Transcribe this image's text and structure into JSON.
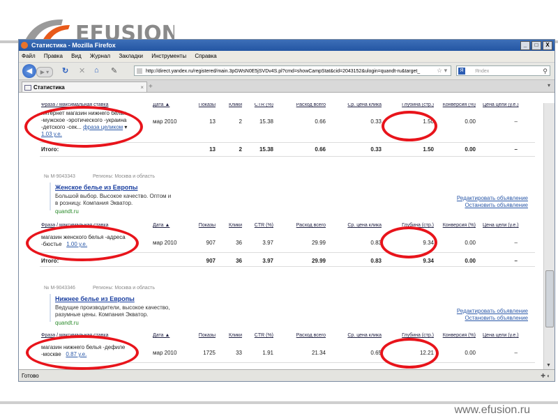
{
  "slide": {
    "logo_text": "EFUSION",
    "site": "www.efusion.ru"
  },
  "window": {
    "title": "Статистика - Mozilla Firefox",
    "buttons": [
      "_",
      "□",
      "X"
    ],
    "menu": [
      "Файл",
      "Правка",
      "Вид",
      "Журнал",
      "Закладки",
      "Инструменты",
      "Справка"
    ],
    "url": "http://direct.yandex.ru/registered/main.3pGWsN0E5jSVDv4S.pl?cmd=showCampStat&cid=2043152&ulogin=quandt-ru&target_",
    "search_placeholder": "Яndex",
    "tab_label": "Статистика",
    "status": "Готово"
  },
  "columns": {
    "phrase": "Фраза / максимальная ставка",
    "date": "Дата ▲",
    "shows": "Показы",
    "clicks": "Клики",
    "ctr": "CTR (%)",
    "spend": "Расход всего",
    "cpc": "Ср. цена клика",
    "depth": "Глубина (стр.)",
    "conv": "Конверсия (%)",
    "goal": "Цена цели (у.е.)"
  },
  "total_label": "Итого:",
  "block1": {
    "phrase_lines": [
      "интернет магазин нижнего белья",
      "-мужское -эротического -украина",
      "-детского -сек..."
    ],
    "phrase_link": "фраза целиком",
    "bid_link": "1.03 у.е.",
    "row": {
      "date": "мар 2010",
      "shows": "13",
      "clicks": "2",
      "ctr": "15.38",
      "spend": "0.66",
      "cpc": "0.33",
      "depth": "1.50",
      "conv": "0.00",
      "goal": "–"
    },
    "total": {
      "shows": "13",
      "clicks": "2",
      "ctr": "15.38",
      "spend": "0.66",
      "cpc": "0.33",
      "depth": "1.50",
      "conv": "0.00",
      "goal": "–"
    }
  },
  "block2": {
    "ad_id": "№ M-9043343",
    "regions": "Регионы: Москва и область",
    "ad_title": "Женское белье из Европы",
    "ad_text": [
      "Большой выбор. Высокое качество. Оптом и",
      "в розницу. Компания Экватор."
    ],
    "ad_url": "quandt.ru",
    "edit_link": "Редактировать объявление",
    "stop_link": "Остановить объявление",
    "phrase_lines": [
      "магазин женского белья -адреса",
      "-бюстье"
    ],
    "bid_link": "1.00 у.е.",
    "row": {
      "date": "мар 2010",
      "shows": "907",
      "clicks": "36",
      "ctr": "3.97",
      "spend": "29.99",
      "cpc": "0.83",
      "depth": "9.34",
      "conv": "0.00",
      "goal": "–"
    },
    "total": {
      "shows": "907",
      "clicks": "36",
      "ctr": "3.97",
      "spend": "29.99",
      "cpc": "0.83",
      "depth": "9.34",
      "conv": "0.00",
      "goal": "–"
    }
  },
  "block3": {
    "ad_id": "№ M-9043346",
    "regions": "Регионы: Москва и область",
    "ad_title": "Нижнее белье из Европы",
    "ad_text": [
      "Ведущие производители, высокое качество,",
      "разумные цены. Компания Экватор."
    ],
    "ad_url": "quandt.ru",
    "edit_link": "Редактировать объявление",
    "stop_link": "Остановить объявление",
    "phrase_lines": [
      "магазин нижнего белья -дефиле",
      "-москве"
    ],
    "bid_link": "0.87 у.е.",
    "row": {
      "date": "мар 2010",
      "shows": "1725",
      "clicks": "33",
      "ctr": "1.91",
      "spend": "21.34",
      "cpc": "0.65",
      "depth": "12.21",
      "conv": "0.00",
      "goal": "–"
    }
  },
  "colors": {
    "highlight": "#e8141b",
    "link": "#2a58a8",
    "title_bar": "#2456a3"
  }
}
